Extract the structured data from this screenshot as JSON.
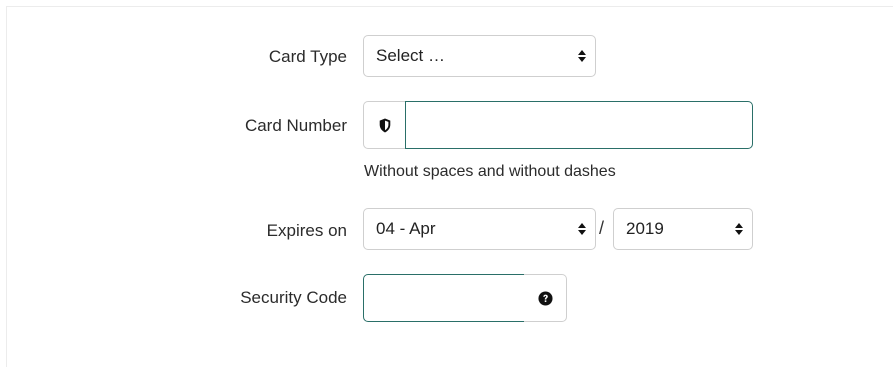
{
  "form": {
    "card_type": {
      "label": "Card Type",
      "selected": "Select …"
    },
    "card_number": {
      "label": "Card Number",
      "value": "",
      "addon_icon": "shield-icon",
      "help_text": "Without spaces and without dashes"
    },
    "expires": {
      "label": "Expires on",
      "month_selected": "04 - Apr",
      "separator": "/",
      "year_selected": "2019"
    },
    "security_code": {
      "label": "Security Code",
      "value": "",
      "addon_icon": "question-circle-icon"
    }
  },
  "colors": {
    "input_focus_border": "#2a6f68",
    "default_border": "#cfcfcf"
  }
}
